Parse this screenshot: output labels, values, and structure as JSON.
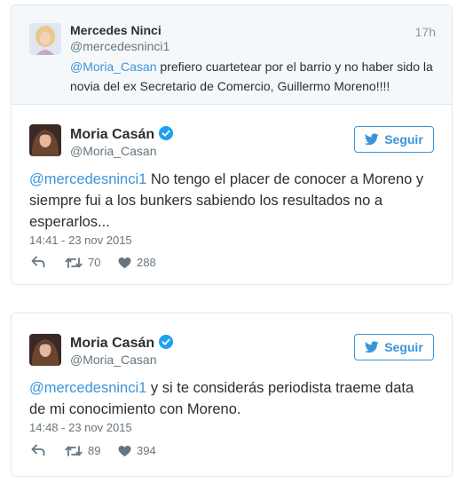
{
  "parent_tweet": {
    "name": "Mercedes Ninci",
    "handle": "@mercedesninci1",
    "time": "17h",
    "mention": "@Moria_Casan",
    "text": " prefiero cuartetear por el barrio y no haber sido la novia del ex Secretario de Comercio, Guillermo Moreno!!!!"
  },
  "tweets": [
    {
      "name": "Moria Casán",
      "handle": "@Moria_Casan",
      "follow_label": "Seguir",
      "mention": "@mercedesninci1",
      "text": " No tengo el placer de conocer a Moreno y siempre fui a los bunkers sabiendo los resultados no a esperarlos...",
      "timestamp": "14:41 - 23 nov 2015",
      "retweets": "70",
      "likes": "288"
    },
    {
      "name": "Moria Casán",
      "handle": "@Moria_Casan",
      "follow_label": "Seguir",
      "mention": "@mercedesninci1",
      "text": " y si te considerás periodista traeme data de mi conocimiento con Moreno.",
      "timestamp": "14:48 - 23 nov 2015",
      "retweets": "89",
      "likes": "394"
    }
  ],
  "colors": {
    "link": "#3b94d9",
    "verified": "#1da1f2",
    "muted": "#66757f",
    "parent_bg": "#f5f8fa"
  },
  "icons": [
    "verified-badge-icon",
    "twitter-bird-icon",
    "reply-icon",
    "retweet-icon",
    "heart-icon"
  ]
}
